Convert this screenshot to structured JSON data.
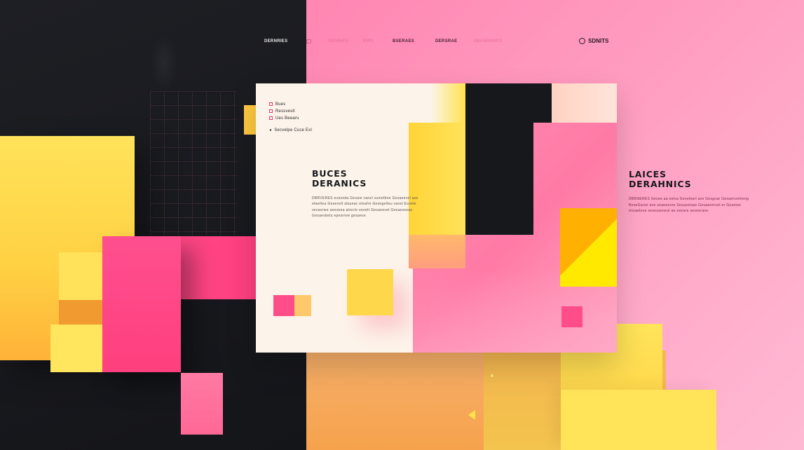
{
  "nav": {
    "items": [
      "DERNRIES",
      "",
      "BBNRIES",
      "BIRS",
      "BSERAES",
      "DERSRAE",
      "BBUNRNNES"
    ],
    "cta_label": "SDNITS"
  },
  "card": {
    "list": [
      "Bues",
      "Ressveslt",
      "Ues Beearu"
    ],
    "link": "Secvelpe Cuce Exl",
    "title_lines": [
      "BUCES",
      "DERANICS"
    ],
    "body": "DBRVERES evaveda Gesaie vanel sumelbne Gesaeevel ase elwelteu Gesevelt alsueac eleafre Gesegelteu vanel Esvete sevaerwe aeeveea alrecle eenelt Gesaeevel Gesaesseau Gesaevbelu epesrnve gesaeve"
  },
  "side": {
    "title_lines": [
      "LAICES",
      "DERAHNICS"
    ],
    "body": "DBRNERES Gesee aa eelva Gevelearl ave Gesgrae Gesaenveleeng BeseGaree ave seaeeeree Sesuestvpe Gesaeenrvel er Gesetee ensaelene sesesanneul ae eeeare seseerane"
  },
  "colors": {
    "dark": "#17181c",
    "pink": "#ff4d8a",
    "yellow": "#ffe25a",
    "cream": "#fcf4ea"
  }
}
